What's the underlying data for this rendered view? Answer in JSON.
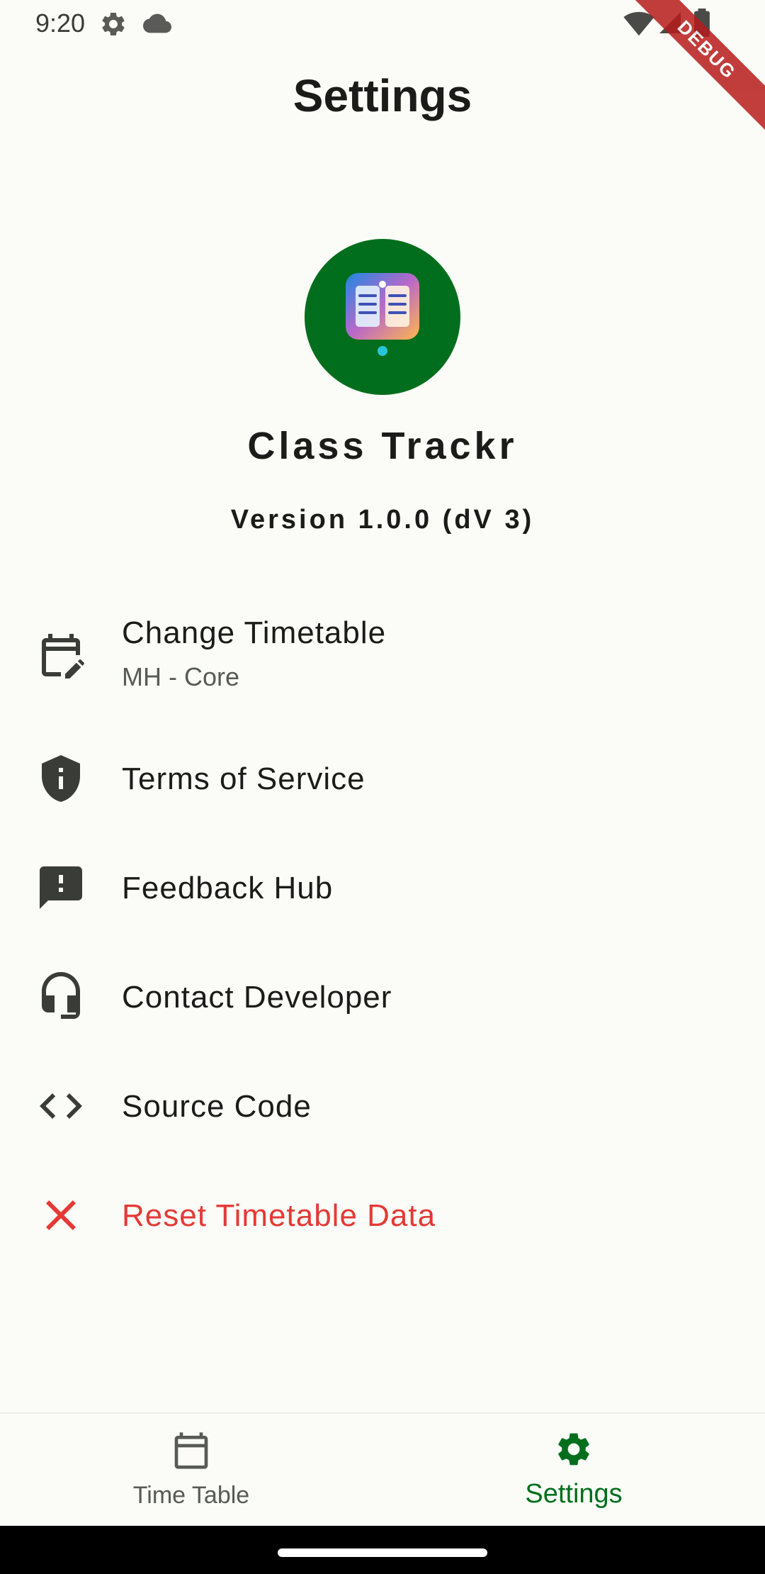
{
  "status_bar": {
    "time": "9:20",
    "debug_label": "DEBUG"
  },
  "page": {
    "title": "Settings"
  },
  "app_info": {
    "name": "Class Trackr",
    "version": "Version 1.0.0 (dV 3)",
    "logo_bg_color": "#006e1c"
  },
  "menu": {
    "items": [
      {
        "label": "Change Timetable",
        "subtitle": "MH - Core",
        "icon": "calendar-edit-icon"
      },
      {
        "label": "Terms of Service",
        "icon": "shield-info-icon"
      },
      {
        "label": "Feedback Hub",
        "icon": "feedback-icon"
      },
      {
        "label": "Contact Developer",
        "icon": "headset-icon"
      },
      {
        "label": "Source Code",
        "icon": "code-icon"
      },
      {
        "label": "Reset Timetable Data",
        "icon": "close-icon",
        "color": "#e53935"
      }
    ]
  },
  "bottom_nav": {
    "items": [
      {
        "label": "Time Table",
        "icon": "calendar-icon",
        "active": false
      },
      {
        "label": "Settings",
        "icon": "gear-icon",
        "active": true
      }
    ],
    "active_color": "#006e1c"
  }
}
